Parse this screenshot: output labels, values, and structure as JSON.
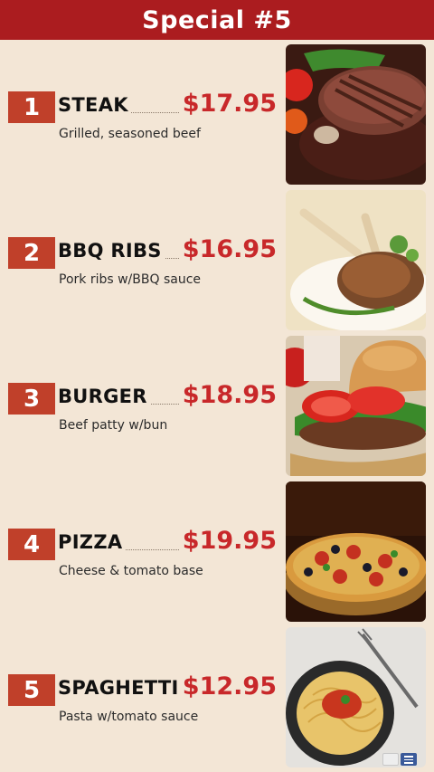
{
  "header": {
    "title": "Special #5"
  },
  "items": [
    {
      "number": "1",
      "name": "STEAK",
      "price": "$17.95",
      "description": "Grilled, seasoned beef",
      "image": "steak-photo"
    },
    {
      "number": "2",
      "name": "BBQ RIBS",
      "price": "$16.95",
      "description": "Pork ribs w/BBQ sauce",
      "image": "bbq-ribs-photo"
    },
    {
      "number": "3",
      "name": "BURGER",
      "price": "$18.95",
      "description": "Beef patty w/bun",
      "image": "burger-photo"
    },
    {
      "number": "4",
      "name": "PIZZA",
      "price": "$19.95",
      "description": "Cheese & tomato base",
      "image": "pizza-photo"
    },
    {
      "number": "5",
      "name": "SPAGHETTI",
      "price": "$12.95",
      "description": "Pasta w/tomato sauce",
      "image": "spaghetti-photo"
    }
  ],
  "colors": {
    "header_bg": "#ab1c1f",
    "number_bg": "#c0402a",
    "price": "#c8282a",
    "page_bg": "#f3e6d6"
  }
}
